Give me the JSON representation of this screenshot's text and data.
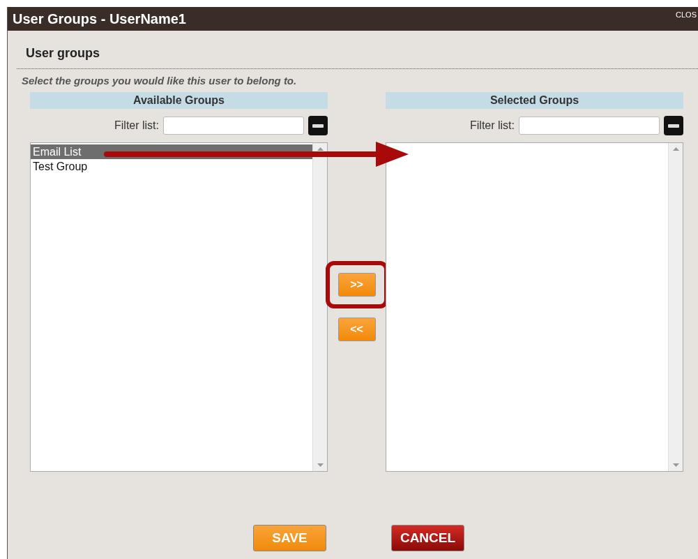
{
  "window": {
    "title": "User Groups - UserName1",
    "close": "CLOS"
  },
  "section": {
    "heading": "User groups",
    "instruction": "Select the groups you would like this user to belong to."
  },
  "available": {
    "header": "Available Groups",
    "filter_label": "Filter list:",
    "items": [
      {
        "label": "Email List",
        "selected": true
      },
      {
        "label": "Test Group",
        "selected": false
      }
    ]
  },
  "move_buttons": [
    {
      "label": ">>",
      "highlighted": true
    },
    {
      "label": "<<",
      "highlighted": false
    }
  ],
  "selected": {
    "header": "Selected Groups",
    "filter_label": "Filter list:"
  },
  "buttons": [
    {
      "label": "SAVE",
      "kind": "save"
    },
    {
      "label": "CANCEL",
      "kind": "cancel"
    }
  ]
}
